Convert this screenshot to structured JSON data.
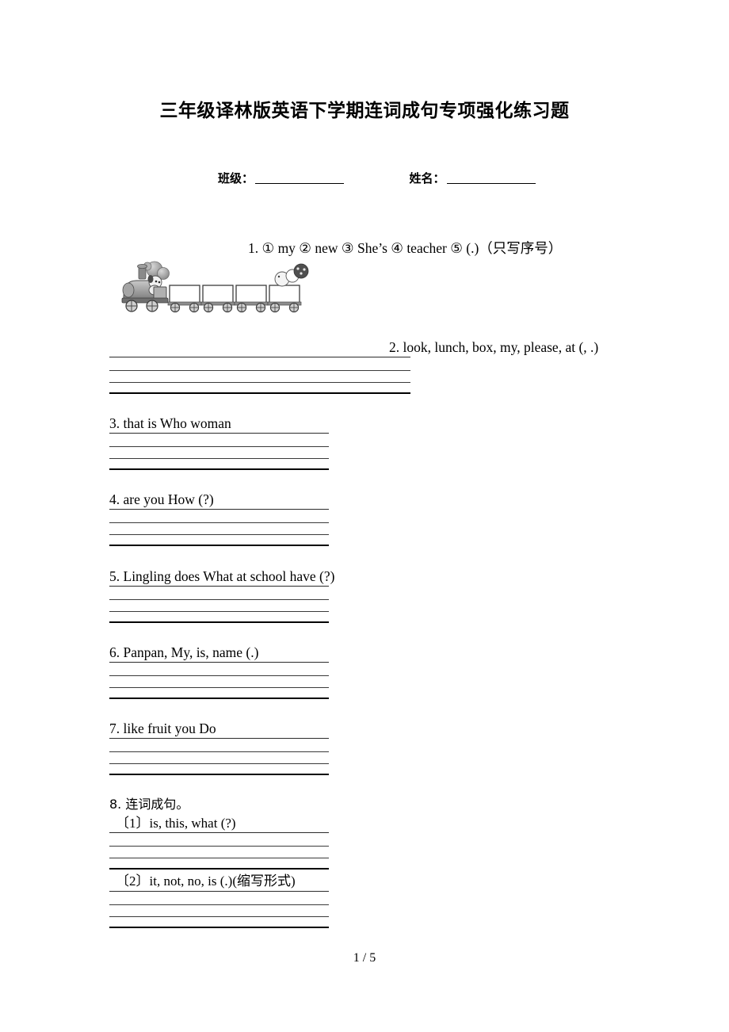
{
  "document": {
    "title": "三年级译林版英语下学期连词成句专项强化练习题",
    "footer_page": "1 / 5"
  },
  "info_row": {
    "class_label": "班级：",
    "name_label": "姓名："
  },
  "questions": [
    {
      "number": "1.",
      "prompt": "1. ① my ② new ③ She’s  ④ teacher  ⑤ (.)（只写序号）",
      "illustration": "train-with-five-boxes",
      "answer_boxes": 5
    },
    {
      "number": "2.",
      "prompt": "2. look, lunch, box, my, please, at  (, .)"
    },
    {
      "number": "3.",
      "prompt": "3. that  is  Who  woman"
    },
    {
      "number": "4.",
      "prompt": "4. are    you     How (?)"
    },
    {
      "number": "5.",
      "prompt": "5. Lingling  does  What  at  school  have  (?)"
    },
    {
      "number": "6.",
      "prompt": "6. Panpan, My, is, name (.)"
    },
    {
      "number": "7.",
      "prompt": "7. like  fruit  you  Do"
    },
    {
      "number": "8.",
      "prompt": "8. 连词成句。",
      "sub_items": [
        {
          "label": "〔1〕is, this, what (?)"
        },
        {
          "label": "〔2〕it, not, no, is (.)(缩写形式)"
        }
      ]
    }
  ]
}
